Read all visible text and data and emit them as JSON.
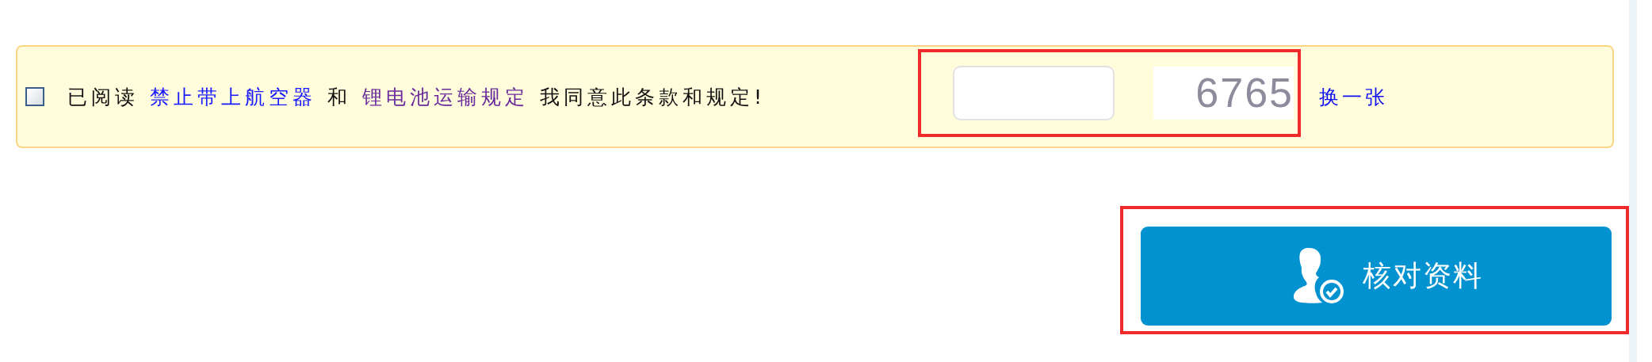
{
  "agreement": {
    "checked": false,
    "prefix": "已阅读",
    "links": [
      {
        "text": "禁止带上航空器",
        "visited": false
      },
      {
        "text": "锂电池运输规定",
        "visited": true
      }
    ],
    "joiner": "和",
    "suffix": "我同意此条款和规定!"
  },
  "captcha": {
    "code": "6765",
    "refresh_link": "换一张",
    "highlighted": true
  },
  "submit_button": {
    "label": "核对资料",
    "highlighted": true
  }
}
